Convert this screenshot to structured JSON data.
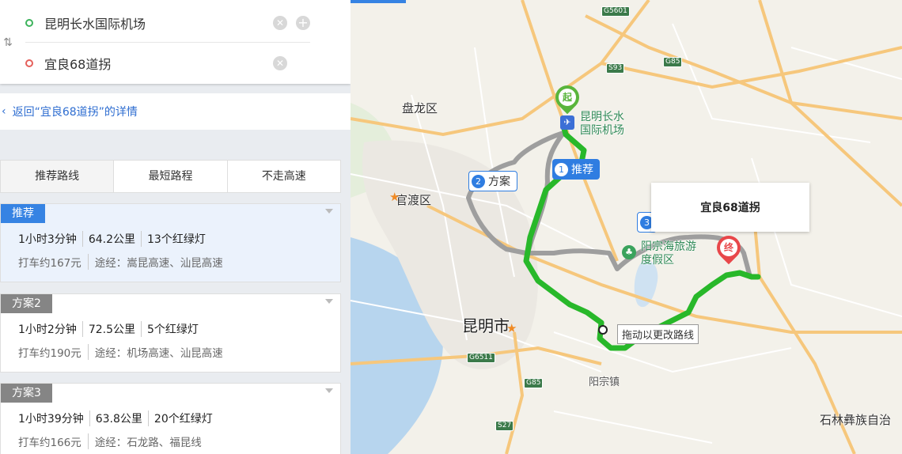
{
  "search": {
    "start": "昆明长水国际机场",
    "end": "宜良68道拐"
  },
  "back_link": "返回“宜良68道拐”的详情",
  "tabs": [
    {
      "label": "推荐路线",
      "active": true
    },
    {
      "label": "最短路程",
      "active": false
    },
    {
      "label": "不走高速",
      "active": false
    }
  ],
  "routes": [
    {
      "badge": "推荐",
      "time": "1小时3分钟",
      "distance": "64.2公里",
      "lights": "13个红绿灯",
      "taxi": "打车约167元",
      "via": "途经：嵩昆高速、汕昆高速",
      "selected": true
    },
    {
      "badge": "方案2",
      "time": "1小时2分钟",
      "distance": "72.5公里",
      "lights": "5个红绿灯",
      "taxi": "打车约190元",
      "via": "途经：机场高速、汕昆高速",
      "selected": false
    },
    {
      "badge": "方案3",
      "time": "1小时39分钟",
      "distance": "63.8公里",
      "lights": "20个红绿灯",
      "taxi": "打车约166元",
      "via": "途经：石龙路、福昆线",
      "selected": false
    }
  ],
  "map": {
    "places": {
      "panlong": "盘龙区",
      "guandu": "官渡区",
      "kunming": "昆明市",
      "yangzong": "阳宗镇",
      "shilin": "石林彝族自治",
      "airport": "昆明长水\n国际机场",
      "resort": "阳宗海旅游\n度假区"
    },
    "shields": {
      "g5601": "G5601",
      "g85a": "G85",
      "s93": "S93",
      "g85b": "G85",
      "g6511": "G6511",
      "s27": "S27"
    },
    "route_tags": {
      "recommended": {
        "num": "1",
        "label": "推荐"
      },
      "plan2": {
        "num": "2",
        "label": "方案"
      },
      "plan3": {
        "num": "3"
      }
    },
    "start_pin": "起",
    "end_pin": "终",
    "destination_card": "宜良68道拐",
    "drag_tip": "拖动以更改路线",
    "colors": {
      "route_selected": "#28b82a",
      "route_alt": "#9e9e9e",
      "highway": "#f6c77c",
      "water": "#b7d5ee",
      "start_pin": "#59b53b",
      "end_pin": "#e8474a",
      "accent": "#3683e3"
    }
  }
}
